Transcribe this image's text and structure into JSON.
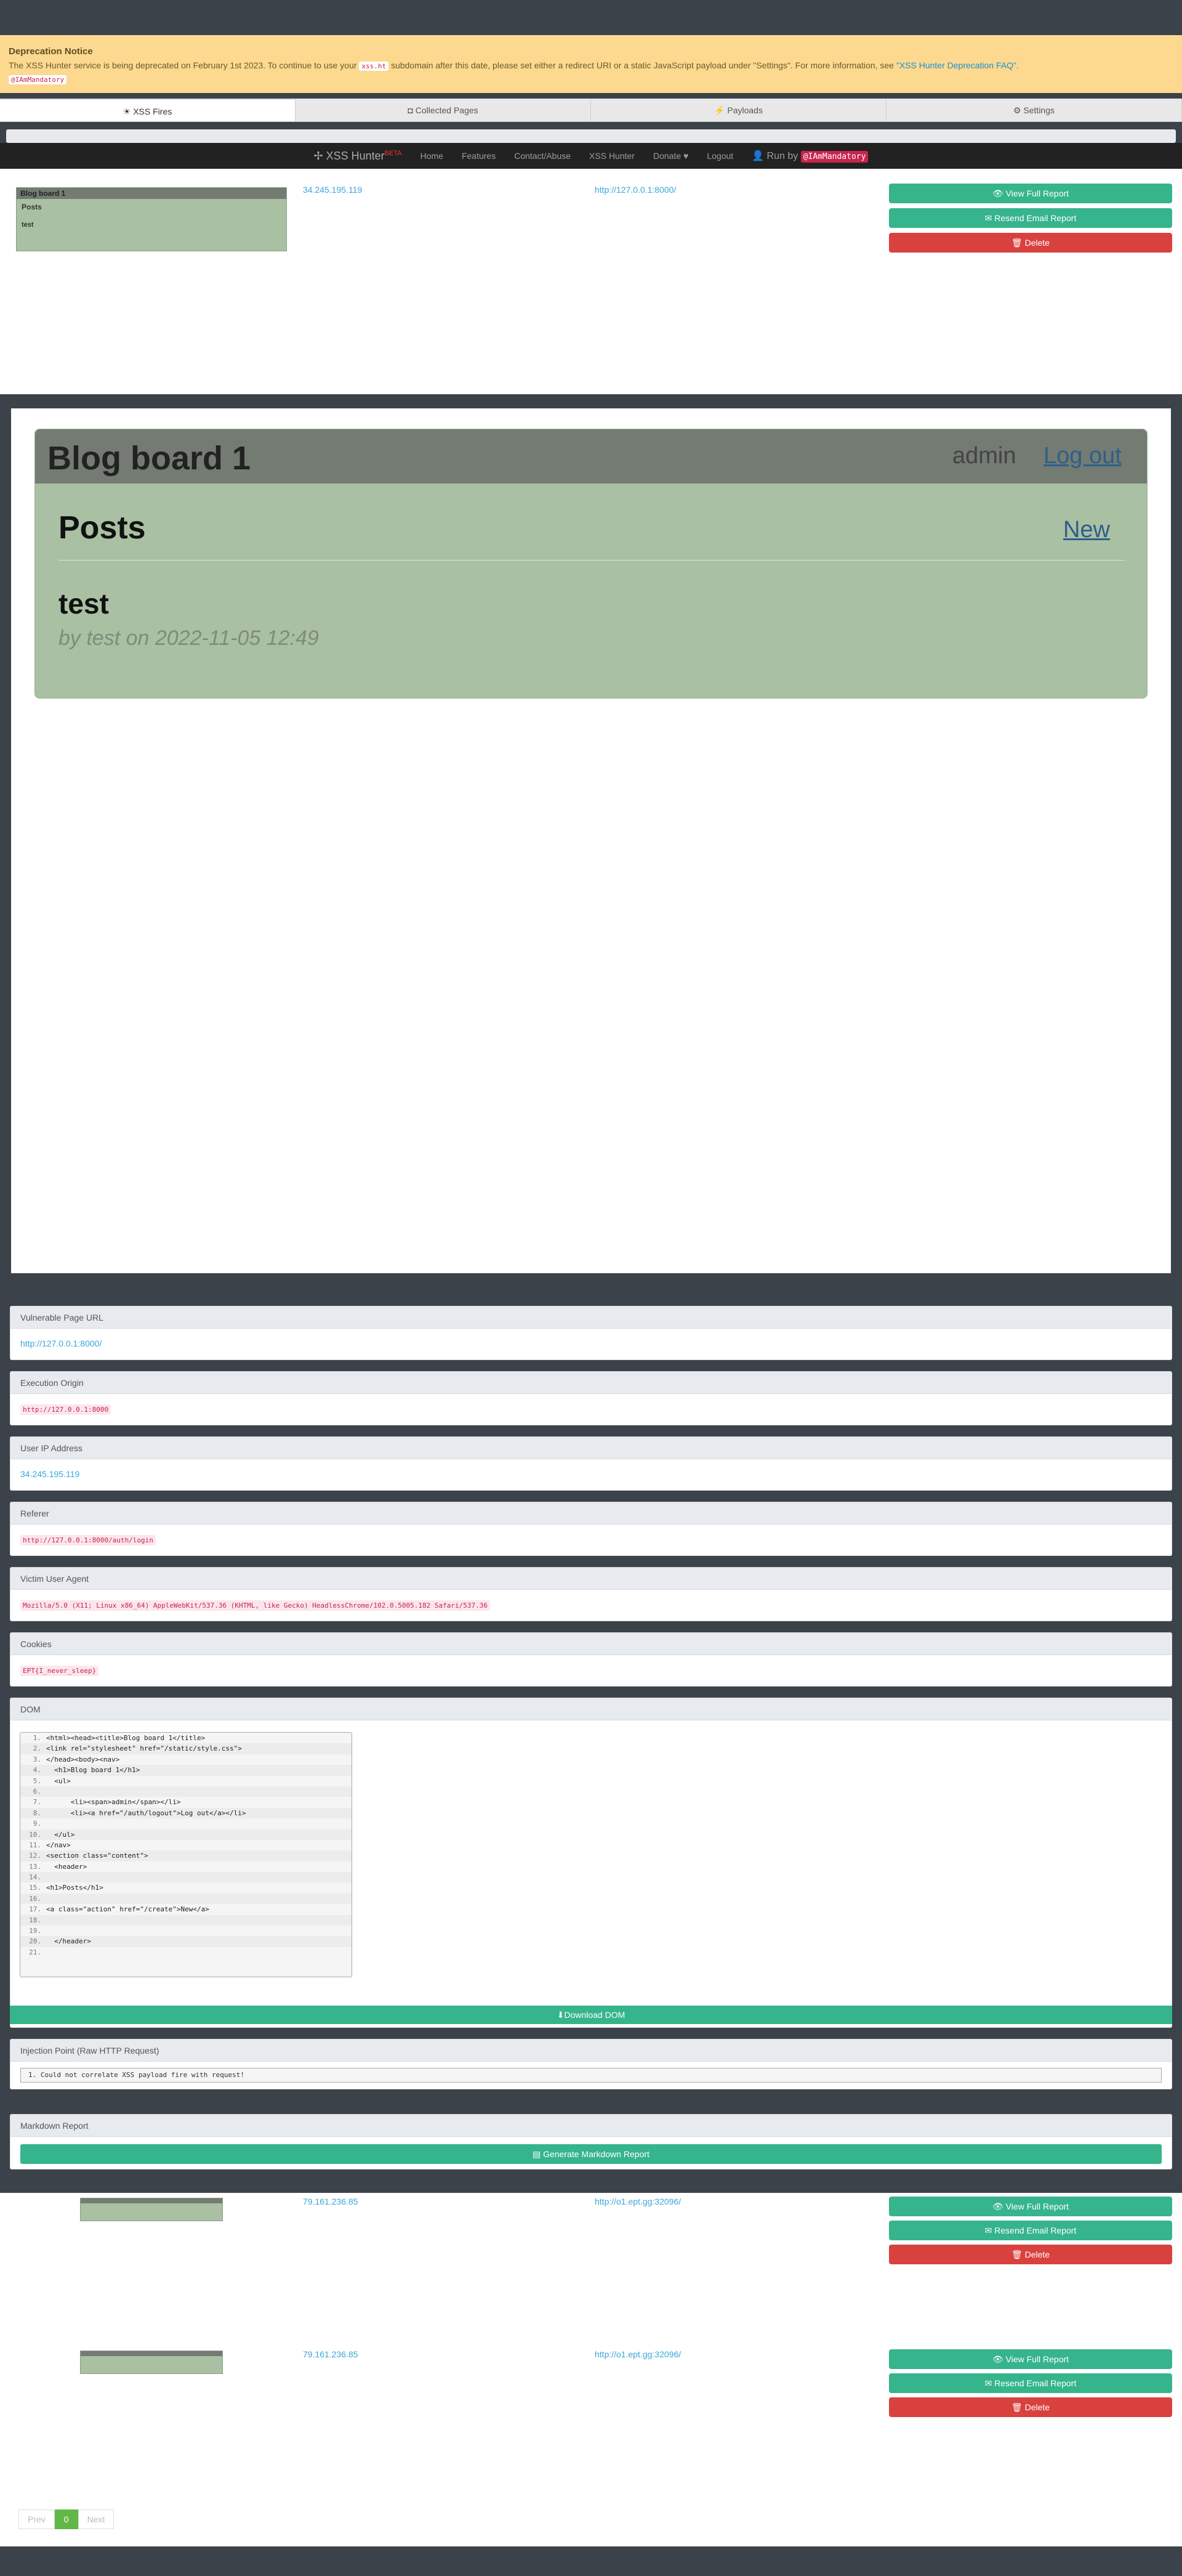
{
  "notice": {
    "title": "Deprecation Notice",
    "text_pre": "The XSS Hunter service is being deprecated on February 1st 2023. To continue to use your",
    "code": "xss.ht",
    "text_mid": "subdomain after this date, please set either a redirect URI or a static JavaScript payload under \"Settings\". For more information, see",
    "link": "\"XSS Hunter Deprecation FAQ\".",
    "handle": "@IAmMandatory"
  },
  "tabs": [
    {
      "icon": "☀",
      "label": "XSS Fires"
    },
    {
      "icon": "◘",
      "label": "Collected Pages"
    },
    {
      "icon": "⚡",
      "label": "Payloads"
    },
    {
      "icon": "⚙",
      "label": "Settings"
    }
  ],
  "nav": {
    "brand": "XSS Hunter",
    "beta": "BETA",
    "links": [
      "Home",
      "Features",
      "Contact/Abuse",
      "XSS Hunter",
      "Donate ♥",
      "Logout"
    ],
    "run_by": "Run by",
    "handle": "@IAmMandatory"
  },
  "fires": [
    {
      "ip": "34.245.195.119",
      "url": "http://127.0.0.1:8000/"
    },
    {
      "ip": "79.161.236.85",
      "url": "http://o1.ept.gg:32096/"
    },
    {
      "ip": "79.161.236.85",
      "url": "http://o1.ept.gg:32096/"
    }
  ],
  "buttons": {
    "view": "View Full Report",
    "resend": "Resend Email Report",
    "delete": "Delete"
  },
  "blog": {
    "title": "Blog board 1",
    "user": "admin",
    "logout": "Log out",
    "posts": "Posts",
    "new": "New",
    "post_title": "test",
    "post_meta": "by test on 2022-11-05 12:49"
  },
  "details": {
    "vuln_url_label": "Vulnerable Page URL",
    "vuln_url": "http://127.0.0.1:8000/",
    "origin_label": "Execution Origin",
    "origin": "http://127.0.0.1:8000",
    "ip_label": "User IP Address",
    "ip": "34.245.195.119",
    "referer_label": "Referer",
    "referer": "http://127.0.0.1:8000/auth/login",
    "ua_label": "Victim User Agent",
    "ua": "Mozilla/5.0 (X11; Linux x86_64) AppleWebKit/537.36 (KHTML, like Gecko) HeadlessChrome/102.0.5005.182 Safari/537.36",
    "cookies_label": "Cookies",
    "cookies": "EPT{I_never_sleep}",
    "dom_label": "DOM",
    "download": "Download DOM",
    "injection_label": "Injection Point (Raw HTTP Request)",
    "injection": "Could not correlate XSS payload fire with request!",
    "markdown_label": "Markdown Report",
    "markdown_btn": "Generate Markdown Report"
  },
  "dom_lines": [
    "<html><head><title>Blog board 1</title>",
    "<link rel=\"stylesheet\" href=\"/static/style.css\">",
    "</head><body><nav>",
    "  <h1>Blog board 1</h1>",
    "  <ul>",
    "",
    "      <li><span>admin</span></li>",
    "      <li><a href=\"/auth/logout\">Log out</a></li>",
    "",
    "  </ul>",
    "</nav>",
    "<section class=\"content\">",
    "  <header>",
    "",
    "<h1>Posts</h1>",
    "",
    "<a class=\"action\" href=\"/create\">New</a>",
    "",
    "",
    "  </header>",
    ""
  ],
  "pager": {
    "prev": "Prev",
    "page": "0",
    "next": "Next"
  }
}
